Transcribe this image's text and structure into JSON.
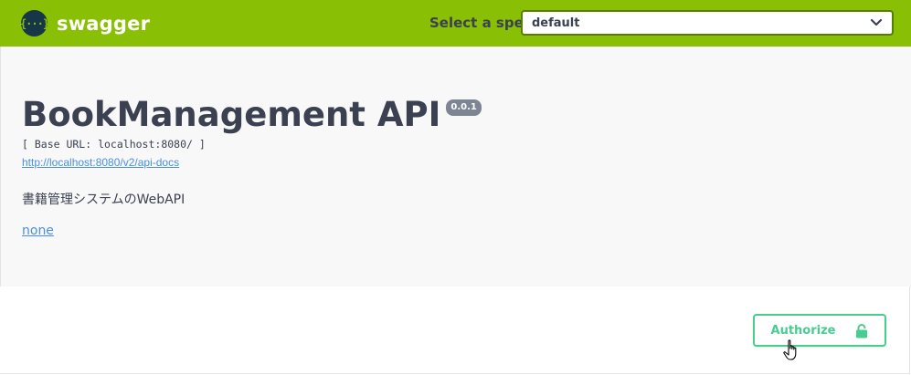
{
  "header": {
    "logo_text": "swagger",
    "logo_glyph": "{···}",
    "spec_label": "Select a spec",
    "spec_selected": "default",
    "brand_color": "#89bf04"
  },
  "info": {
    "title": "BookManagement API",
    "version": "0.0.1",
    "base_url": "[ Base URL: localhost:8080/ ]",
    "docs_link": "http://localhost:8080/v2/api-docs",
    "description": "書籍管理システムのWebAPI",
    "license_link": "none"
  },
  "auth": {
    "button_label": "Authorize",
    "icon": "lock-icon",
    "accent_color": "#49cc90"
  }
}
